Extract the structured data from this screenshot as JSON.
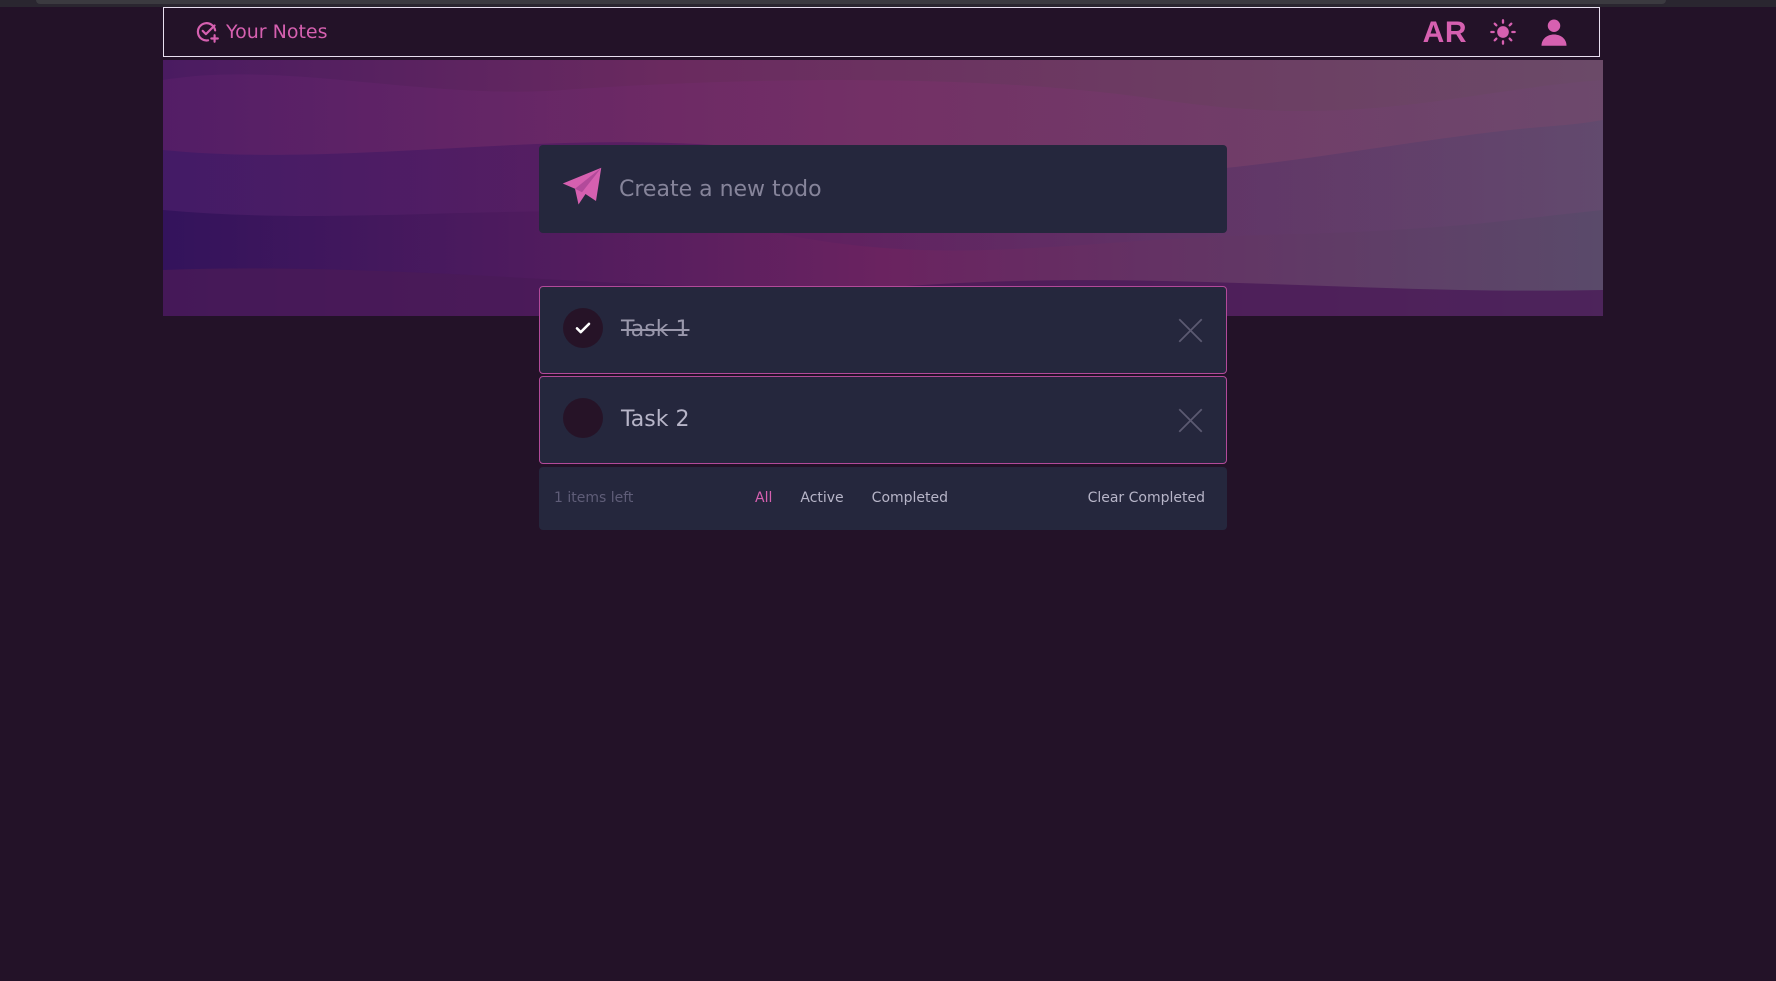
{
  "header": {
    "brand_label": "Your Notes",
    "initials": "AR",
    "brand_icon": "check-circle-plus-icon",
    "theme_icon": "sun-icon",
    "user_icon": "user-icon"
  },
  "new_todo": {
    "placeholder": "Create a new todo",
    "value": "",
    "submit_icon": "paper-plane-icon"
  },
  "todos": [
    {
      "text": "Task 1",
      "completed": true
    },
    {
      "text": "Task 2",
      "completed": false
    }
  ],
  "footer": {
    "items_left": "1 items left",
    "filters": [
      "All",
      "Active",
      "Completed"
    ],
    "active_filter": "All",
    "clear_label": "Clear Completed"
  },
  "colors": {
    "background": "#231228",
    "panel": "#25273d",
    "accent": "#d660b0",
    "item_border": "#b24a9a"
  }
}
